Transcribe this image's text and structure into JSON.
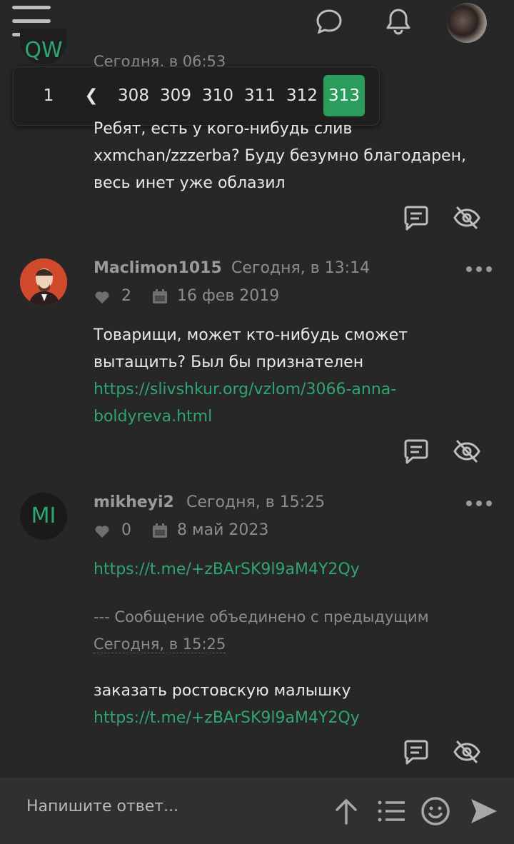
{
  "top_bar": {
    "icons": [
      "menu-icon",
      "chat-bubble-icon",
      "bell-icon",
      "user-avatar"
    ]
  },
  "pagination": {
    "first": "1",
    "prev": "❮",
    "pages": [
      "308",
      "309",
      "310",
      "311",
      "312",
      "313"
    ],
    "current": "313"
  },
  "posts": [
    {
      "avatar_initials": "QW",
      "date": "Сегодня, в 06:53",
      "lines": [
        "Ребят, есть у кого-нибудь слив",
        "xxmchan/zzzerba? Буду безумно благодарен,",
        "весь инет уже облазил"
      ]
    },
    {
      "username": "Maclimon1015",
      "date": "Сегодня, в 13:14",
      "likes": "2",
      "joined": "16 фев 2019",
      "lines": [
        "Товарищи, может кто-нибудь сможет",
        "вытащить? Был бы признателен"
      ],
      "link_lines": [
        "https://slivshkur.org/vzlom/3066-anna-",
        "boldyreva.html"
      ]
    },
    {
      "avatar_initials": "MI",
      "username": "mikheyi2",
      "date": "Сегодня, в 15:25",
      "likes": "0",
      "joined": "8 май 2023",
      "link1": "https://t.me/+zBArSK9l9aM4Y2Qy",
      "merged_note": "--- Сообщение объединено с предыдущим",
      "merged_date": "Сегодня, в 15:25",
      "text": "заказать ростовскую малышку",
      "link2": "https://t.me/+zBArSK9l9aM4Y2Qy"
    }
  ],
  "reply_bar": {
    "placeholder": "Напишите ответ..."
  },
  "colors": {
    "background": "#272727",
    "accent": "#2a9d5c",
    "link": "#2fa56f"
  }
}
